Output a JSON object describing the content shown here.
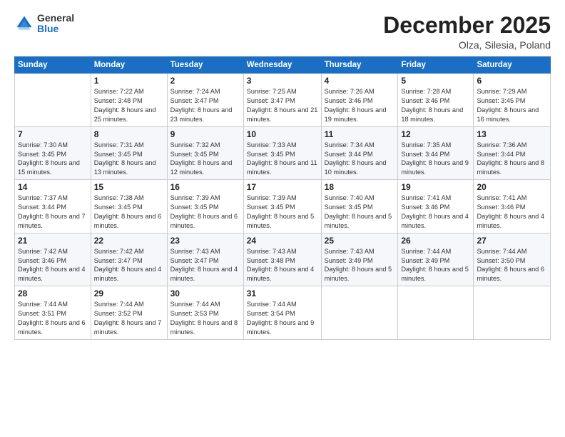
{
  "logo": {
    "general": "General",
    "blue": "Blue"
  },
  "header": {
    "month": "December 2025",
    "location": "Olza, Silesia, Poland"
  },
  "weekdays": [
    "Sunday",
    "Monday",
    "Tuesday",
    "Wednesday",
    "Thursday",
    "Friday",
    "Saturday"
  ],
  "weeks": [
    [
      {
        "day": "",
        "sunrise": "",
        "sunset": "",
        "daylight": ""
      },
      {
        "day": "1",
        "sunrise": "Sunrise: 7:22 AM",
        "sunset": "Sunset: 3:48 PM",
        "daylight": "Daylight: 8 hours and 25 minutes."
      },
      {
        "day": "2",
        "sunrise": "Sunrise: 7:24 AM",
        "sunset": "Sunset: 3:47 PM",
        "daylight": "Daylight: 8 hours and 23 minutes."
      },
      {
        "day": "3",
        "sunrise": "Sunrise: 7:25 AM",
        "sunset": "Sunset: 3:47 PM",
        "daylight": "Daylight: 8 hours and 21 minutes."
      },
      {
        "day": "4",
        "sunrise": "Sunrise: 7:26 AM",
        "sunset": "Sunset: 3:46 PM",
        "daylight": "Daylight: 8 hours and 19 minutes."
      },
      {
        "day": "5",
        "sunrise": "Sunrise: 7:28 AM",
        "sunset": "Sunset: 3:46 PM",
        "daylight": "Daylight: 8 hours and 18 minutes."
      },
      {
        "day": "6",
        "sunrise": "Sunrise: 7:29 AM",
        "sunset": "Sunset: 3:45 PM",
        "daylight": "Daylight: 8 hours and 16 minutes."
      }
    ],
    [
      {
        "day": "7",
        "sunrise": "Sunrise: 7:30 AM",
        "sunset": "Sunset: 3:45 PM",
        "daylight": "Daylight: 8 hours and 15 minutes."
      },
      {
        "day": "8",
        "sunrise": "Sunrise: 7:31 AM",
        "sunset": "Sunset: 3:45 PM",
        "daylight": "Daylight: 8 hours and 13 minutes."
      },
      {
        "day": "9",
        "sunrise": "Sunrise: 7:32 AM",
        "sunset": "Sunset: 3:45 PM",
        "daylight": "Daylight: 8 hours and 12 minutes."
      },
      {
        "day": "10",
        "sunrise": "Sunrise: 7:33 AM",
        "sunset": "Sunset: 3:45 PM",
        "daylight": "Daylight: 8 hours and 11 minutes."
      },
      {
        "day": "11",
        "sunrise": "Sunrise: 7:34 AM",
        "sunset": "Sunset: 3:44 PM",
        "daylight": "Daylight: 8 hours and 10 minutes."
      },
      {
        "day": "12",
        "sunrise": "Sunrise: 7:35 AM",
        "sunset": "Sunset: 3:44 PM",
        "daylight": "Daylight: 8 hours and 9 minutes."
      },
      {
        "day": "13",
        "sunrise": "Sunrise: 7:36 AM",
        "sunset": "Sunset: 3:44 PM",
        "daylight": "Daylight: 8 hours and 8 minutes."
      }
    ],
    [
      {
        "day": "14",
        "sunrise": "Sunrise: 7:37 AM",
        "sunset": "Sunset: 3:44 PM",
        "daylight": "Daylight: 8 hours and 7 minutes."
      },
      {
        "day": "15",
        "sunrise": "Sunrise: 7:38 AM",
        "sunset": "Sunset: 3:45 PM",
        "daylight": "Daylight: 8 hours and 6 minutes."
      },
      {
        "day": "16",
        "sunrise": "Sunrise: 7:39 AM",
        "sunset": "Sunset: 3:45 PM",
        "daylight": "Daylight: 8 hours and 6 minutes."
      },
      {
        "day": "17",
        "sunrise": "Sunrise: 7:39 AM",
        "sunset": "Sunset: 3:45 PM",
        "daylight": "Daylight: 8 hours and 5 minutes."
      },
      {
        "day": "18",
        "sunrise": "Sunrise: 7:40 AM",
        "sunset": "Sunset: 3:45 PM",
        "daylight": "Daylight: 8 hours and 5 minutes."
      },
      {
        "day": "19",
        "sunrise": "Sunrise: 7:41 AM",
        "sunset": "Sunset: 3:46 PM",
        "daylight": "Daylight: 8 hours and 4 minutes."
      },
      {
        "day": "20",
        "sunrise": "Sunrise: 7:41 AM",
        "sunset": "Sunset: 3:46 PM",
        "daylight": "Daylight: 8 hours and 4 minutes."
      }
    ],
    [
      {
        "day": "21",
        "sunrise": "Sunrise: 7:42 AM",
        "sunset": "Sunset: 3:46 PM",
        "daylight": "Daylight: 8 hours and 4 minutes."
      },
      {
        "day": "22",
        "sunrise": "Sunrise: 7:42 AM",
        "sunset": "Sunset: 3:47 PM",
        "daylight": "Daylight: 8 hours and 4 minutes."
      },
      {
        "day": "23",
        "sunrise": "Sunrise: 7:43 AM",
        "sunset": "Sunset: 3:47 PM",
        "daylight": "Daylight: 8 hours and 4 minutes."
      },
      {
        "day": "24",
        "sunrise": "Sunrise: 7:43 AM",
        "sunset": "Sunset: 3:48 PM",
        "daylight": "Daylight: 8 hours and 4 minutes."
      },
      {
        "day": "25",
        "sunrise": "Sunrise: 7:43 AM",
        "sunset": "Sunset: 3:49 PM",
        "daylight": "Daylight: 8 hours and 5 minutes."
      },
      {
        "day": "26",
        "sunrise": "Sunrise: 7:44 AM",
        "sunset": "Sunset: 3:49 PM",
        "daylight": "Daylight: 8 hours and 5 minutes."
      },
      {
        "day": "27",
        "sunrise": "Sunrise: 7:44 AM",
        "sunset": "Sunset: 3:50 PM",
        "daylight": "Daylight: 8 hours and 6 minutes."
      }
    ],
    [
      {
        "day": "28",
        "sunrise": "Sunrise: 7:44 AM",
        "sunset": "Sunset: 3:51 PM",
        "daylight": "Daylight: 8 hours and 6 minutes."
      },
      {
        "day": "29",
        "sunrise": "Sunrise: 7:44 AM",
        "sunset": "Sunset: 3:52 PM",
        "daylight": "Daylight: 8 hours and 7 minutes."
      },
      {
        "day": "30",
        "sunrise": "Sunrise: 7:44 AM",
        "sunset": "Sunset: 3:53 PM",
        "daylight": "Daylight: 8 hours and 8 minutes."
      },
      {
        "day": "31",
        "sunrise": "Sunrise: 7:44 AM",
        "sunset": "Sunset: 3:54 PM",
        "daylight": "Daylight: 8 hours and 9 minutes."
      },
      {
        "day": "",
        "sunrise": "",
        "sunset": "",
        "daylight": ""
      },
      {
        "day": "",
        "sunrise": "",
        "sunset": "",
        "daylight": ""
      },
      {
        "day": "",
        "sunrise": "",
        "sunset": "",
        "daylight": ""
      }
    ]
  ]
}
